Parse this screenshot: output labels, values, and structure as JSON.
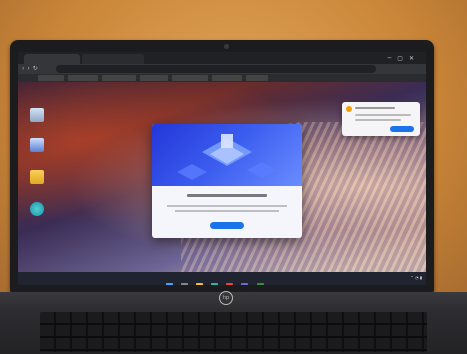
{
  "photo": {
    "subject": "Laptop displaying Windows desktop with browser popup",
    "brand_logo": "hp"
  },
  "colors": {
    "popup_accent": "#1a73e8",
    "hero_blue": "#2f4fe8",
    "notification_icon": "#f29f05"
  },
  "icons": [
    "recycle-bin-icon",
    "folder-icon",
    "edge-icon",
    "chrome-icon",
    "start-icon"
  ]
}
